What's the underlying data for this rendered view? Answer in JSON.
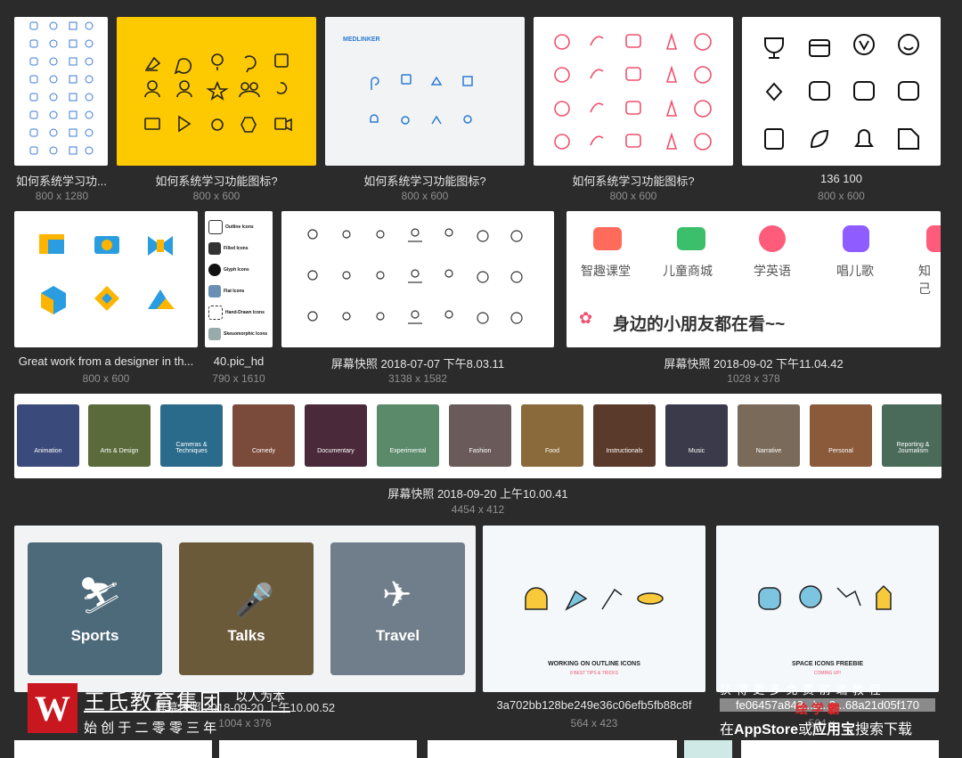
{
  "gallery": {
    "row1": [
      {
        "caption": "如何系统学习功...",
        "size": "800 x 1280"
      },
      {
        "caption": "如何系统学习功能图标?",
        "size": "800 x 600"
      },
      {
        "caption": "如何系统学习功能图标?",
        "size": "800 x 600",
        "brand": "MEDLINKER"
      },
      {
        "caption": "如何系统学习功能图标?",
        "size": "800 x 600"
      },
      {
        "caption": "136 100",
        "size": "800 x 600"
      }
    ],
    "row2": [
      {
        "caption": "Great work from a designer in th...",
        "size": "800 x 600"
      },
      {
        "caption": "40.pic_hd",
        "size": "790 x 1610",
        "labels": [
          "Outline Icons",
          "Filled Icons",
          "Glyph Icons",
          "Flat Icons",
          "Hand-Drawn Icons",
          "Skeuomorphic Icons"
        ]
      },
      {
        "caption": "屏幕快照 2018-07-07 下午8.03.11",
        "size": "3138 x 1582"
      },
      {
        "caption": "屏幕快照 2018-09-02 下午11.04.42",
        "size": "1028 x 378",
        "apps": [
          "智趣课堂",
          "儿童商城",
          "学英语",
          "唱儿歌",
          "知己"
        ],
        "banner": "身边的小朋友都在看~~"
      }
    ],
    "row3": {
      "caption": "屏幕快照 2018-09-20 上午10.00.41",
      "size": "4454 x 412",
      "strip": [
        "Animation",
        "Arts & Design",
        "Cameras & Techniques",
        "Comedy",
        "Documentary",
        "Experimental",
        "Fashion",
        "Food",
        "Instructionals",
        "Music",
        "Narrative",
        "Personal",
        "Reporting & Journalism"
      ]
    },
    "row4": [
      {
        "caption": "屏幕快照 2018-09-20 上午10.00.52",
        "size": "1004 x 376",
        "tiles": [
          "Sports",
          "Talks",
          "Travel"
        ]
      },
      {
        "caption": "3a702bb128be249e36c06efb5fb88c8f",
        "size": "564 x 423",
        "title": "WORKING ON OUTLINE ICONS",
        "subtitle": "8 BEST TIPS & TRICKS"
      },
      {
        "caption": "fe06457a848...b...2...68a21d05f170",
        "size": "564 x ...",
        "title": "SPACE ICONS FREEBIE",
        "subtitle": "COMING UP!"
      }
    ]
  },
  "watermark": {
    "logo_letter": "W",
    "line1": "王氏教育集团",
    "line1_suffix": "以人为本",
    "line2": "始 创 于 二 零 零 三 年",
    "right_line1": "获 得 更 多 免 费 前 端 教 程",
    "right_line2_a": "在",
    "right_line2_b": "AppStore",
    "right_line2_c": "或",
    "right_line2_d": "应用宝",
    "right_line2_e": "搜索下载",
    "right_red": "绘 学 霸"
  },
  "colors": {
    "background": "#2b2b2b",
    "yellow": "#fdc900",
    "pink": "#f0506e",
    "blue": "#2a7bd1"
  }
}
